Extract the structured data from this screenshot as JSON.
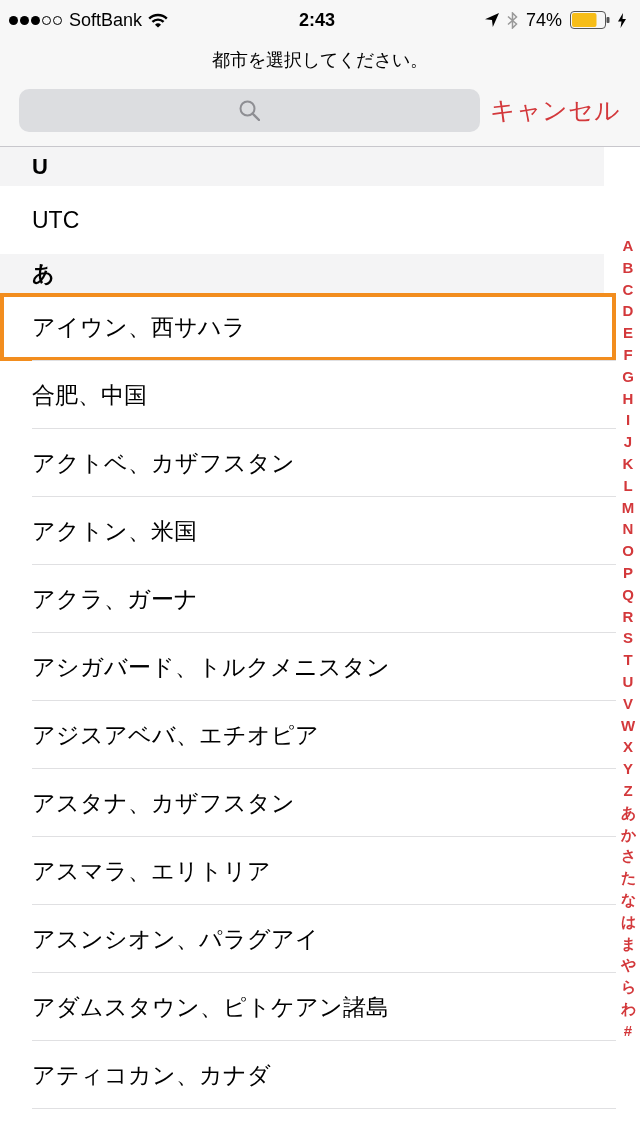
{
  "status_bar": {
    "carrier": "SoftBank",
    "time": "2:43",
    "battery": "74%"
  },
  "header": {
    "title": "都市を選択してください。",
    "cancel_button": "キャンセル"
  },
  "sections": [
    {
      "heading": "U",
      "cities": [
        {
          "name": "UTC",
          "highlighted": false
        }
      ]
    },
    {
      "heading": "あ",
      "cities": [
        {
          "name": "アイウン、西サハラ",
          "highlighted": true
        },
        {
          "name": "合肥、中国",
          "highlighted": false
        },
        {
          "name": "アクトベ、カザフスタン",
          "highlighted": false
        },
        {
          "name": "アクトン、米国",
          "highlighted": false
        },
        {
          "name": "アクラ、ガーナ",
          "highlighted": false
        },
        {
          "name": "アシガバード、トルクメニスタン",
          "highlighted": false
        },
        {
          "name": "アジスアベバ、エチオピア",
          "highlighted": false
        },
        {
          "name": "アスタナ、カザフスタン",
          "highlighted": false
        },
        {
          "name": "アスマラ、エリトリア",
          "highlighted": false
        },
        {
          "name": "アスンシオン、パラグアイ",
          "highlighted": false
        },
        {
          "name": "アダムスタウン、ピトケアン諸島",
          "highlighted": false
        },
        {
          "name": "アティコカン、カナダ",
          "highlighted": false
        }
      ]
    }
  ],
  "index": [
    "A",
    "B",
    "C",
    "D",
    "E",
    "F",
    "G",
    "H",
    "I",
    "J",
    "K",
    "L",
    "M",
    "N",
    "O",
    "P",
    "Q",
    "R",
    "S",
    "T",
    "U",
    "V",
    "W",
    "X",
    "Y",
    "Z",
    "あ",
    "か",
    "さ",
    "た",
    "な",
    "は",
    "ま",
    "や",
    "ら",
    "わ",
    "#"
  ]
}
